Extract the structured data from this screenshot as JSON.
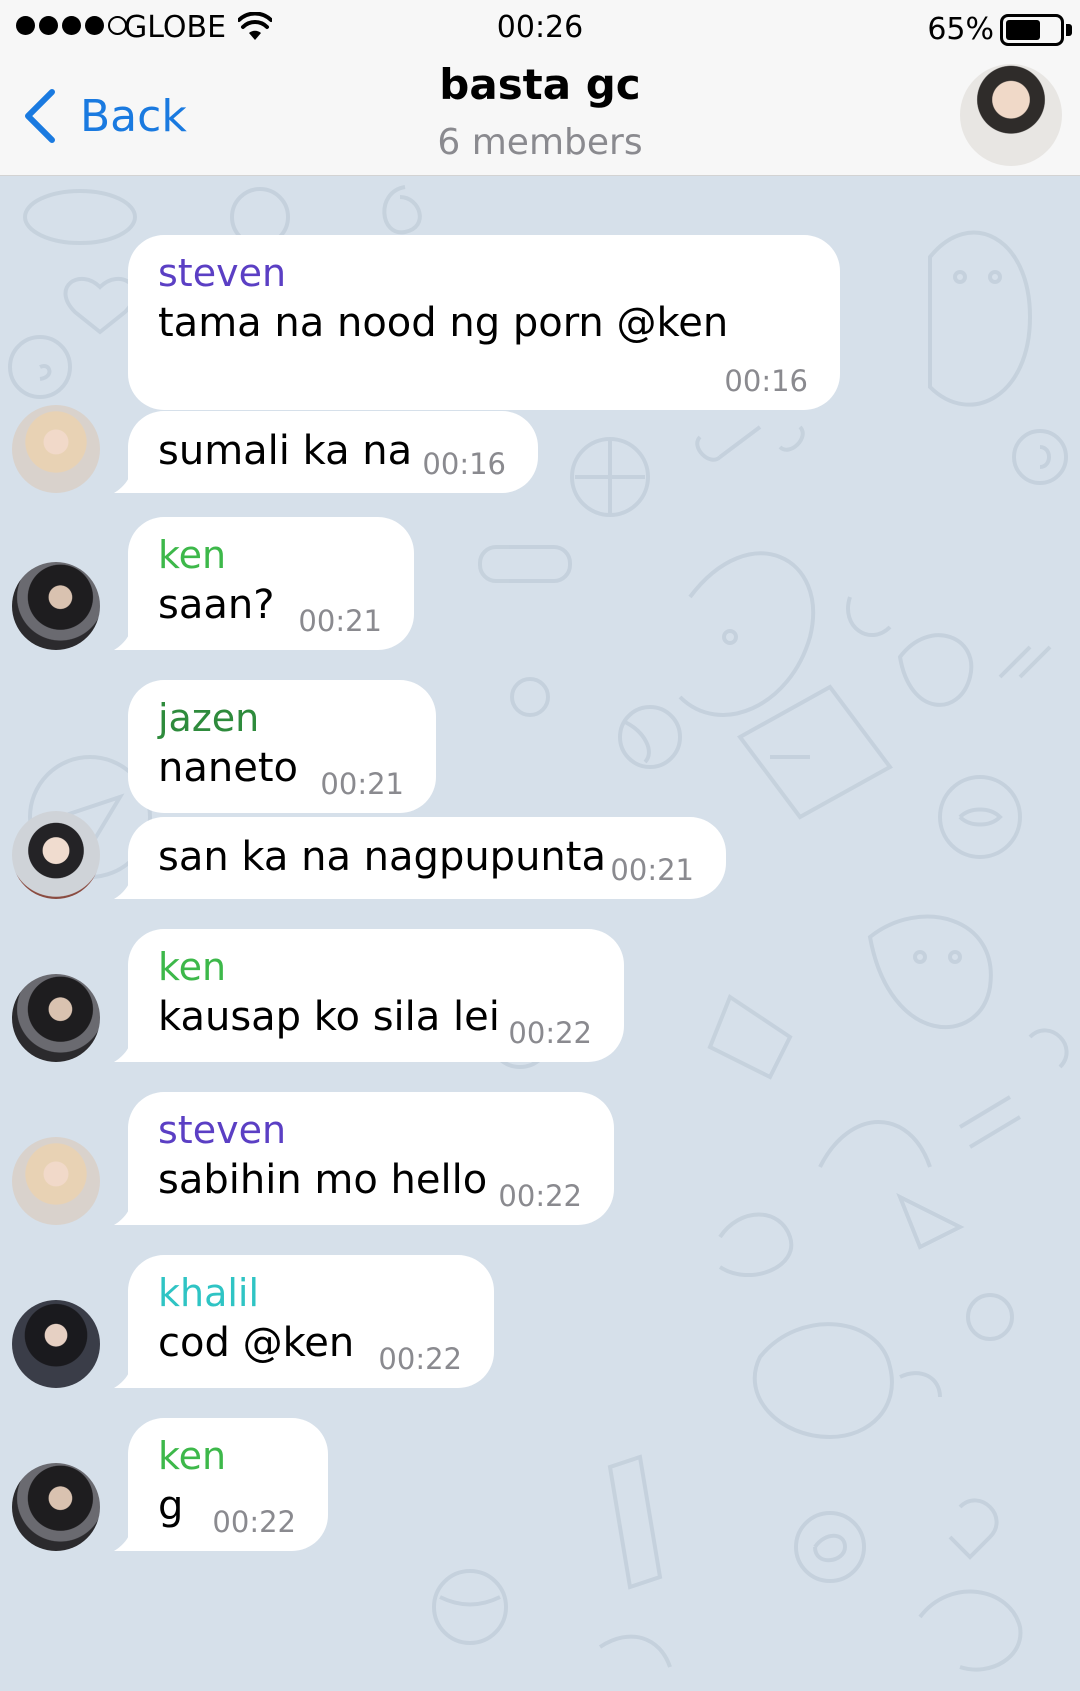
{
  "status_bar": {
    "carrier": "GLOBE",
    "time": "00:26",
    "battery_percent": "65%",
    "battery_level": 0.65,
    "signal_bars_filled": 4,
    "signal_bars_total": 5
  },
  "nav": {
    "back_label": "Back",
    "title": "basta gc",
    "subtitle": "6 members",
    "accent_color": "#1a7ae0"
  },
  "messages": [
    {
      "sender": "steven",
      "sender_color": "#5b3fc4",
      "text": "tama na nood ng porn @ken",
      "time": "00:16"
    },
    {
      "sender": "",
      "text": "sumali ka na",
      "time": "00:16",
      "avatar": "steven-avatar"
    },
    {
      "sender": "ken",
      "sender_color": "#3db84a",
      "text": "saan?",
      "time": "00:21",
      "avatar": "ken-avatar"
    },
    {
      "sender": "jazen",
      "sender_color": "#2e8b3c",
      "text": "naneto",
      "time": "00:21"
    },
    {
      "sender": "",
      "text": "san ka na nagpupunta",
      "time": "00:21",
      "avatar": "jazen-avatar"
    },
    {
      "sender": "ken",
      "sender_color": "#3db84a",
      "text": "kausap ko sila lei",
      "time": "00:22",
      "avatar": "ken-avatar"
    },
    {
      "sender": "steven",
      "sender_color": "#5b3fc4",
      "text": "sabihin mo hello",
      "time": "00:22",
      "avatar": "steven-avatar"
    },
    {
      "sender": "khalil",
      "sender_color": "#2fc4c4",
      "text": "cod @ken",
      "time": "00:22",
      "avatar": "khalil-avatar"
    },
    {
      "sender": "ken",
      "sender_color": "#3db84a",
      "text": "g",
      "time": "00:22",
      "avatar": "ken-avatar"
    }
  ]
}
